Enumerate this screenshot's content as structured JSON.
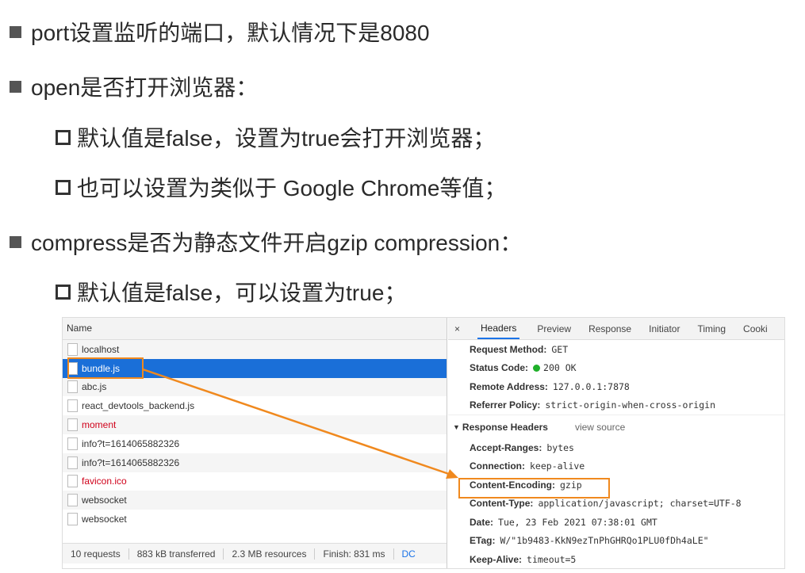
{
  "slide": {
    "bullets": [
      {
        "text": "port设置监听的端口，默认情况下是8080"
      },
      {
        "text": "open是否打开浏览器："
      },
      {
        "text": "默认值是false，设置为true会打开浏览器；"
      },
      {
        "text": "也可以设置为类似于 Google Chrome等值；"
      },
      {
        "text": "compress是否为静态文件开启gzip compression："
      },
      {
        "text": "默认值是false，可以设置为true；"
      }
    ]
  },
  "network": {
    "name_header": "Name",
    "requests": [
      "localhost",
      "bundle.js",
      "abc.js",
      "react_devtools_backend.js",
      "moment",
      "info?t=1614065882326",
      "info?t=1614065882326",
      "favicon.ico",
      "websocket",
      "websocket"
    ],
    "footer": {
      "requests": "10 requests",
      "transferred": "883 kB transferred",
      "resources": "2.3 MB resources",
      "finish": "Finish: 831 ms",
      "dcl": "DC"
    }
  },
  "details": {
    "close": "×",
    "tabs": [
      "Headers",
      "Preview",
      "Response",
      "Initiator",
      "Timing",
      "Cooki"
    ],
    "general": [
      {
        "k": "Request Method:",
        "v": "GET"
      },
      {
        "k": "Status Code:",
        "v": "200 OK"
      },
      {
        "k": "Remote Address:",
        "v": "127.0.0.1:7878"
      },
      {
        "k": "Referrer Policy:",
        "v": "strict-origin-when-cross-origin"
      }
    ],
    "response_title": "Response Headers",
    "view_source": "view source",
    "response": [
      {
        "k": "Accept-Ranges:",
        "v": "bytes"
      },
      {
        "k": "Connection:",
        "v": "keep-alive"
      },
      {
        "k": "Content-Encoding:",
        "v": "gzip"
      },
      {
        "k": "Content-Type:",
        "v": "application/javascript; charset=UTF-8"
      },
      {
        "k": "Date:",
        "v": "Tue, 23 Feb 2021 07:38:01 GMT"
      },
      {
        "k": "ETag:",
        "v": "W/\"1b9483-KkN9ezTnPhGHRQo1PLU0fDh4aLE\""
      },
      {
        "k": "Keep-Alive:",
        "v": "timeout=5"
      }
    ]
  },
  "colors": {
    "highlight": "#f0891e",
    "selected": "#1a6fd8",
    "error": "#d0021b"
  }
}
